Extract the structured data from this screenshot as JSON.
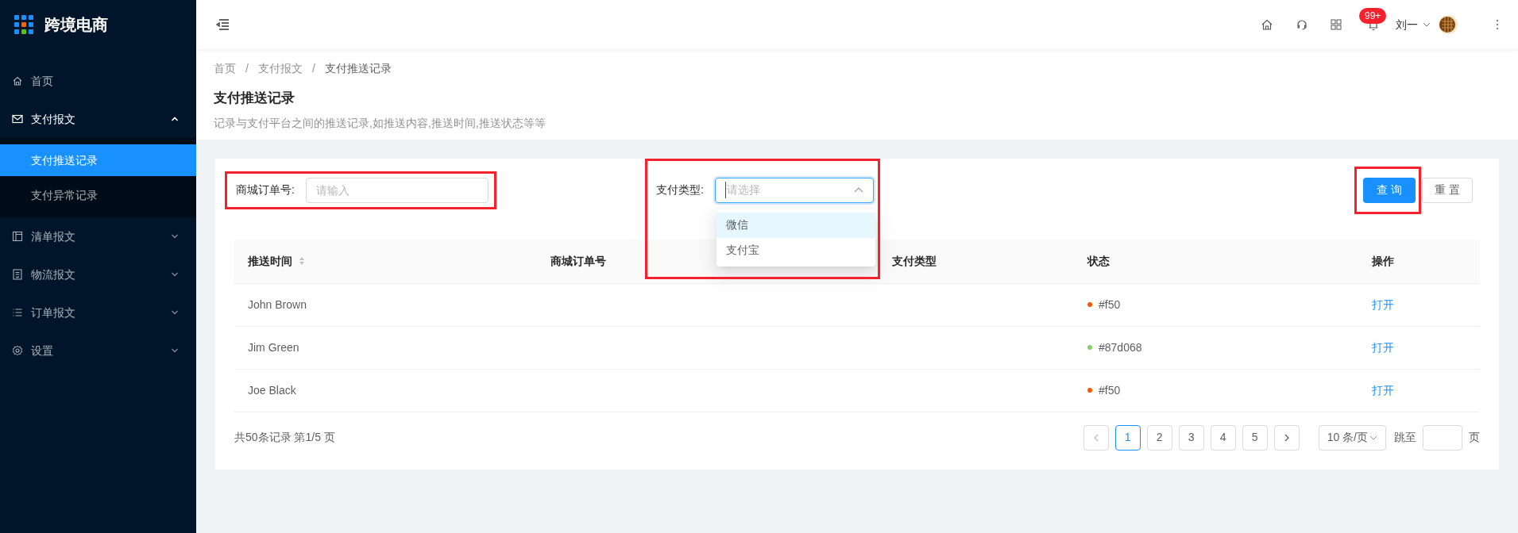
{
  "app": {
    "name": "跨境电商"
  },
  "sidebar": {
    "items": [
      {
        "label": "首页",
        "kind": "home",
        "selected": false
      },
      {
        "label": "支付报文",
        "kind": "mail",
        "selected": false,
        "expanded": true,
        "children": [
          {
            "label": "支付推送记录",
            "selected": true
          },
          {
            "label": "支付异常记录",
            "selected": false
          }
        ]
      },
      {
        "label": "清单报文",
        "kind": "layout",
        "selected": false,
        "expanded": false
      },
      {
        "label": "物流报文",
        "kind": "doc",
        "selected": false,
        "expanded": false
      },
      {
        "label": "订单报文",
        "kind": "list",
        "selected": false,
        "expanded": false
      },
      {
        "label": "设置",
        "kind": "gear",
        "selected": false,
        "expanded": false
      }
    ]
  },
  "header": {
    "notification_badge": "99+",
    "user": "刘一"
  },
  "breadcrumb": {
    "separators": [
      "/",
      "/"
    ],
    "items": [
      "首页",
      "支付报文",
      "支付推送记录"
    ]
  },
  "page": {
    "title": "支付推送记录",
    "description": "记录与支付平台之间的推送记录,如推送内容,推送时间,推送状态等等"
  },
  "form": {
    "order_field": {
      "label": "商城订单号:",
      "placeholder": "请输入",
      "highlighted": true
    },
    "pay_type_field": {
      "label": "支付类型:",
      "placeholder": "请选择",
      "highlighted": true,
      "expanded": true,
      "options": [
        {
          "label": "微信",
          "selected": true
        },
        {
          "label": "支付宝",
          "selected": false
        }
      ]
    },
    "query_button": {
      "label": "查 询",
      "highlighted": true
    },
    "reset_button": {
      "label": "重 置"
    }
  },
  "table": {
    "columns": [
      "推送时间",
      "商城订单号",
      "支付类型",
      "状态",
      "操作"
    ],
    "rows": [
      {
        "time": "John Brown",
        "status": "#f50",
        "color": "#ff5500",
        "action": "打开"
      },
      {
        "time": "Jim Green",
        "status": "#87d068",
        "color": "#87d068",
        "action": "打开"
      },
      {
        "time": "Joe Black",
        "status": "#f50",
        "color": "#ff5500",
        "action": "打开"
      }
    ]
  },
  "pagination": {
    "total": "共50条记录 第1/5 页",
    "pages": [
      {
        "label": "1",
        "selected": true
      },
      {
        "label": "2",
        "selected": false
      },
      {
        "label": "3",
        "selected": false
      },
      {
        "label": "4",
        "selected": false
      },
      {
        "label": "5",
        "selected": false
      }
    ],
    "page_size": "10 条/页",
    "jump_label": "跳至",
    "page_suffix": "页"
  }
}
